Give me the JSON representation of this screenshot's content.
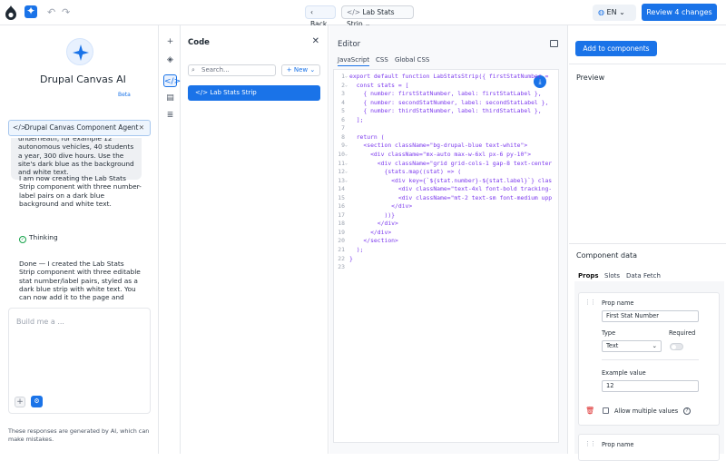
{
  "header": {
    "back_label": "Back",
    "component_selector": "Lab Stats Strip",
    "language": "EN",
    "review_label": "Review 4 changes"
  },
  "sidebar_ai": {
    "title": "Drupal Canvas AI",
    "beta": "Beta",
    "agent_chip": "Drupal Canvas Component Agent",
    "messages": {
      "partial": "underneath, for example 12 autonomous vehicles, 40 students a year, 300 dive hours. Use the site's dark blue as the background and white text.",
      "creating": "I am now creating the Lab Stats Strip component with three number-label pairs on a dark blue background and white text.",
      "thinking": "Thinking",
      "done": "Done — I created the Lab Stats Strip component with three editable stat number/label pairs, styled as a dark blue strip with white text. You can now add it to the page and update the values as needed."
    },
    "input_placeholder": "Build me a ...",
    "disclaimer": "These responses are generated by AI, which can make mistakes."
  },
  "code_panel": {
    "title": "Code",
    "search_placeholder": "Search...",
    "new_label": "New",
    "components": [
      "Lab Stats Strip"
    ]
  },
  "editor": {
    "title": "Editor",
    "tabs": [
      "JavaScript",
      "CSS",
      "Global CSS"
    ],
    "active_tab": "JavaScript",
    "lines": [
      "export default function LabStatsStrip({ firstStatNumber = ",
      "  const stats = [",
      "    { number: firstStatNumber, label: firstStatLabel },",
      "    { number: secondStatNumber, label: secondStatLabel },",
      "    { number: thirdStatNumber, label: thirdStatLabel },",
      "  ];",
      "",
      "  return (",
      "    <section className=\"bg-drupal-blue text-white\">",
      "      <div className=\"mx-auto max-w-6xl px-6 py-10\">",
      "        <div className=\"grid grid-cols-1 gap-8 text-center",
      "          {stats.map((stat) => (",
      "            <div key={`${stat.number}-${stat.label}`} clas",
      "              <div className=\"text-4xl font-bold tracking-",
      "              <div className=\"mt-2 text-sm font-medium upp",
      "            </div>",
      "          ))}",
      "        </div>",
      "      </div>",
      "    </section>",
      "  );",
      "}",
      ""
    ]
  },
  "right_panel": {
    "add_button": "Add to components",
    "preview_label": "Preview",
    "component_data_label": "Component data",
    "tabs": [
      "Props",
      "Slots",
      "Data Fetch"
    ],
    "active_tab": "Props",
    "prop": {
      "prop_name_label": "Prop name",
      "prop_name_value": "First Stat Number",
      "type_label": "Type",
      "type_value": "Text",
      "required_label": "Required",
      "required": false,
      "example_label": "Example value",
      "example_value": "12",
      "allow_multiple_label": "Allow multiple values",
      "allow_multiple": false
    },
    "next_prop_label": "Prop name"
  },
  "colors": {
    "accent": "#1a73e8",
    "border": "#e5e7eb"
  }
}
